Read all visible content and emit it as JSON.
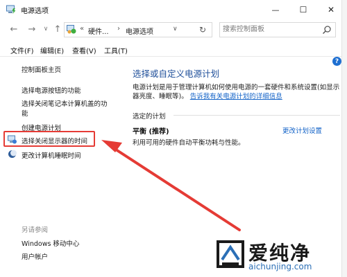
{
  "window": {
    "title": "电源选项",
    "minimize_glyph": "—",
    "maximize_glyph": "☐",
    "close_glyph": "✕"
  },
  "nav": {
    "back_glyph": "←",
    "forward_glyph": "→",
    "dropdown_glyph": "∨",
    "up_glyph": "↑",
    "refresh_glyph": "↻"
  },
  "address": {
    "crumb_overflow": "«",
    "crumb_1": "硬件...",
    "separator": "›",
    "crumb_2": "电源选项",
    "dropdown_glyph": "∨"
  },
  "search": {
    "placeholder": "搜索控制面板"
  },
  "menu": {
    "items": [
      "文件(F)",
      "编辑(E)",
      "查看(V)",
      "工具(T)"
    ]
  },
  "left_pane": {
    "home": "控制面板主页",
    "links": [
      "选择电源按钮的功能",
      "选择关闭笔记本计算机盖的功",
      "能",
      "创建电源计划",
      "选择关闭显示器的时间",
      "更改计算机睡眠时间"
    ],
    "see_also_heading": "另请参阅",
    "see_also": [
      "Windows 移动中心",
      "用户帐户"
    ]
  },
  "main": {
    "title": "选择或自定义电源计划",
    "description": "电源计划是用于管理计算机如何使用电源的一套硬件和系统设置(如显示器亮度、睡眠等)。",
    "description_link": "告诉我有关电源计划的详细信息",
    "section_label": "选定的计划",
    "plan_name": "平衡 (推荐)",
    "plan_change_link": "更改计划设置",
    "plan_description": "利用可用的硬件自动平衡功耗与性能。"
  },
  "help_glyph": "?",
  "watermark": {
    "chinese": "爱纯净",
    "english": "aichunjing.com"
  },
  "colors": {
    "accent_blue": "#1262c7",
    "title_blue": "#1f4f9a",
    "highlight_red": "#e53b35"
  }
}
